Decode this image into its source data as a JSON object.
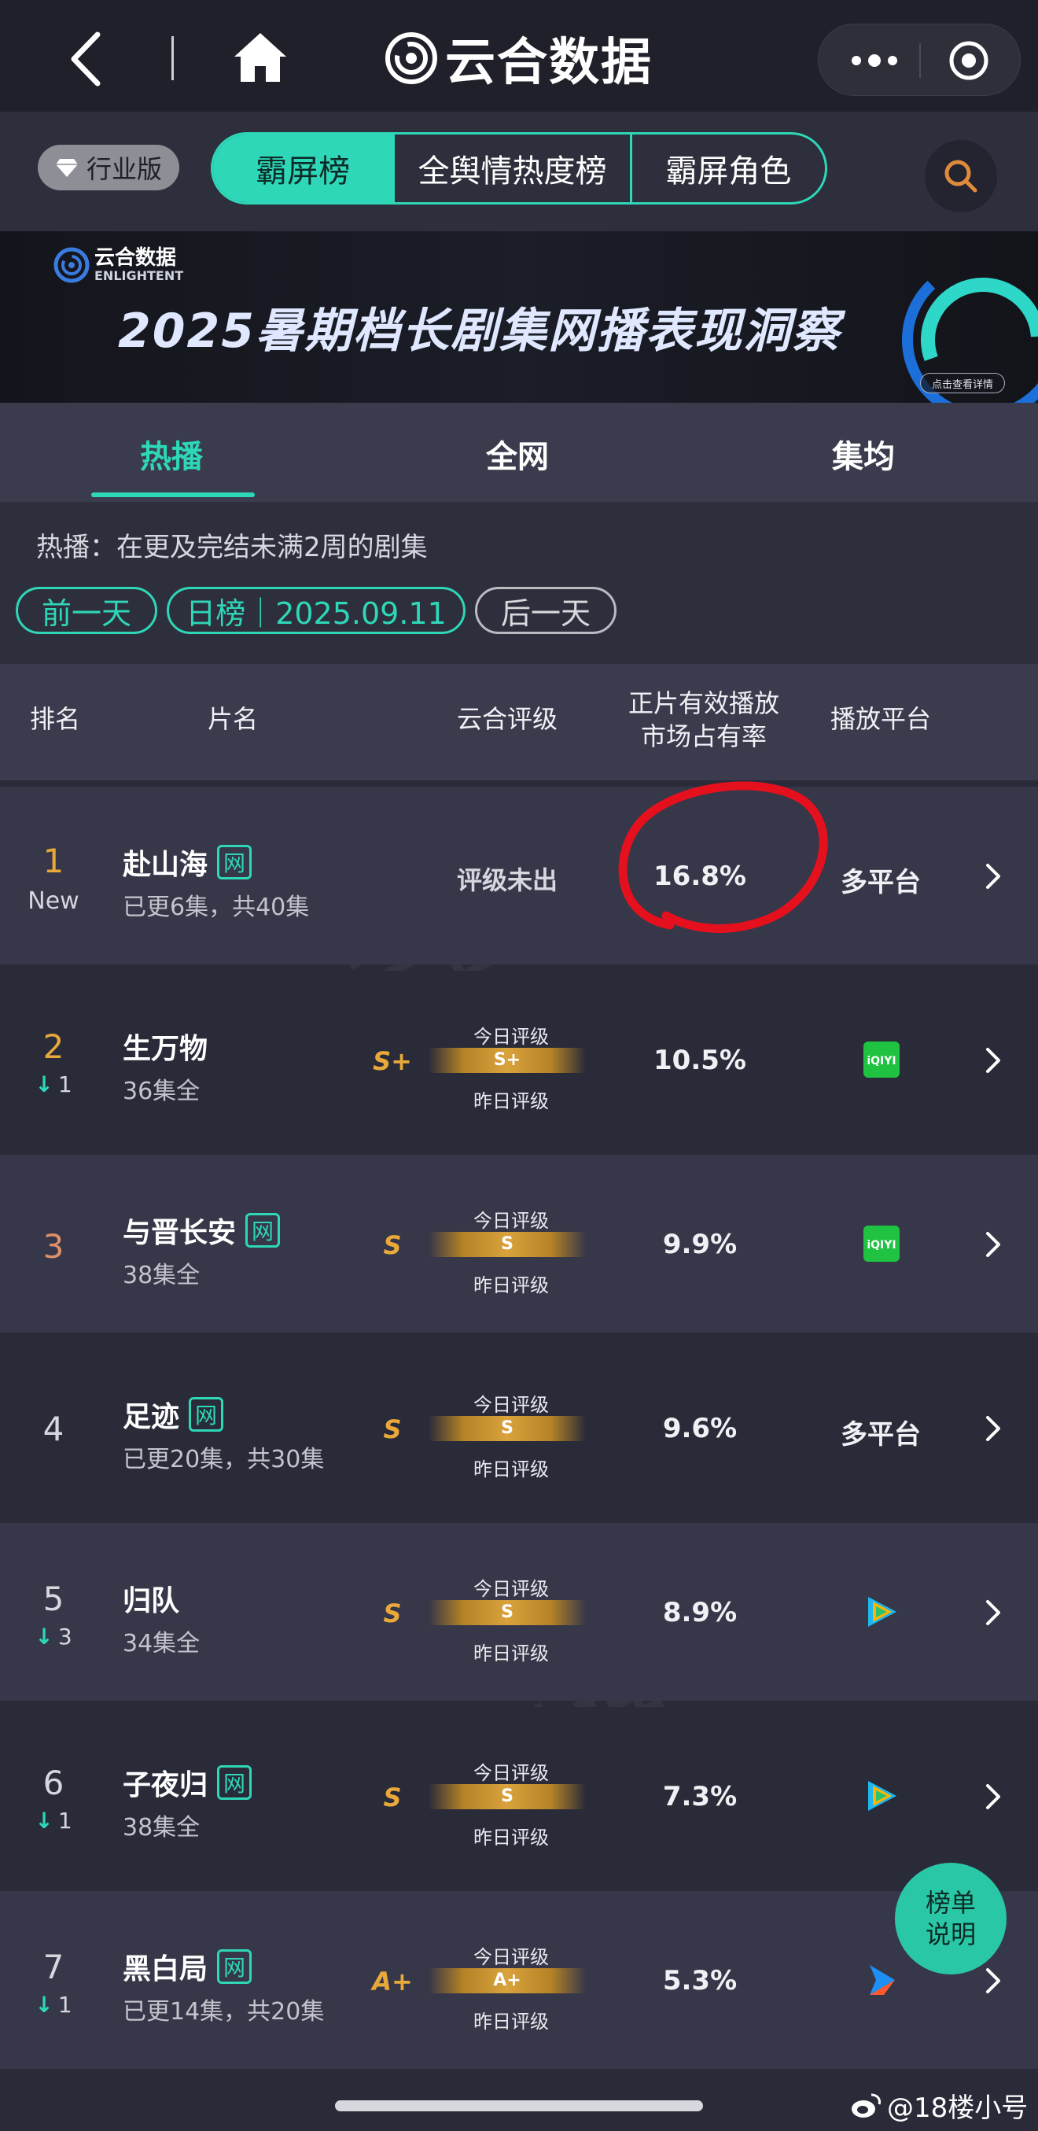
{
  "nav": {
    "brand": "云合数据"
  },
  "filter": {
    "edition_badge": "行业版",
    "segments": [
      "霸屏榜",
      "全舆情热度榜",
      "霸屏角色"
    ]
  },
  "banner": {
    "logo_cn": "云合数据",
    "logo_en": "ENLIGHTENT",
    "title": "2025暑期档长剧集网播表现洞察",
    "detail_button": "点击查看详情"
  },
  "tabs": [
    "热播",
    "全网",
    "集均"
  ],
  "info": {
    "description": "热播：在更及完结未满2周的剧集",
    "prev_day": "前一天",
    "date_label": "日榜｜2025.09.11",
    "next_day": "后一天"
  },
  "table": {
    "headers": {
      "rank": "排名",
      "title": "片名",
      "rating": "云合评级",
      "share_line1": "正片有效播放",
      "share_line2": "市场占有率",
      "platform": "播放平台"
    },
    "rating_today_label": "今日评级",
    "rating_yesterday_label": "昨日评级",
    "rows": [
      {
        "rank": "1",
        "change": "New",
        "title": "赴山海",
        "net_badge": "网",
        "episodes": "已更6集，共40集",
        "grade": "",
        "rating_text": "评级未出",
        "share": "16.8%",
        "platform": "多平台"
      },
      {
        "rank": "2",
        "change": "1",
        "title": "生万物",
        "net_badge": "",
        "episodes": "36集全",
        "grade": "S+",
        "bar_grade": "S+",
        "share": "10.5%",
        "platform": "",
        "platform_icon": "iqiyi-icon"
      },
      {
        "rank": "3",
        "change": "",
        "title": "与晋长安",
        "net_badge": "网",
        "episodes": "38集全",
        "grade": "S",
        "bar_grade": "S",
        "share": "9.9%",
        "platform": "",
        "platform_icon": "iqiyi-icon"
      },
      {
        "rank": "4",
        "change": "",
        "title": "足迹",
        "net_badge": "网",
        "episodes": "已更20集，共30集",
        "grade": "S",
        "bar_grade": "S",
        "share": "9.6%",
        "platform": "多平台"
      },
      {
        "rank": "5",
        "change": "3",
        "title": "归队",
        "net_badge": "",
        "episodes": "34集全",
        "grade": "S",
        "bar_grade": "S",
        "share": "8.9%",
        "platform": "",
        "platform_icon": "tencent-video-icon"
      },
      {
        "rank": "6",
        "change": "1",
        "title": "子夜归",
        "net_badge": "网",
        "episodes": "38集全",
        "grade": "S",
        "bar_grade": "S",
        "share": "7.3%",
        "platform": "",
        "platform_icon": "tencent-video-icon"
      },
      {
        "rank": "7",
        "change": "1",
        "title": "黑白局",
        "net_badge": "网",
        "episodes": "已更14集，共20集",
        "grade": "A+",
        "bar_grade": "A+",
        "share": "5.3%",
        "platform": "",
        "platform_icon": "youku-icon"
      }
    ]
  },
  "fab": {
    "line1": "榜单",
    "line2": "说明"
  },
  "credit": "@18楼小号",
  "colors": {
    "accent": "#2ed7b8",
    "gold": "#e8a83a",
    "annotation_red": "#e5101d",
    "bg": "#2a2b39"
  }
}
